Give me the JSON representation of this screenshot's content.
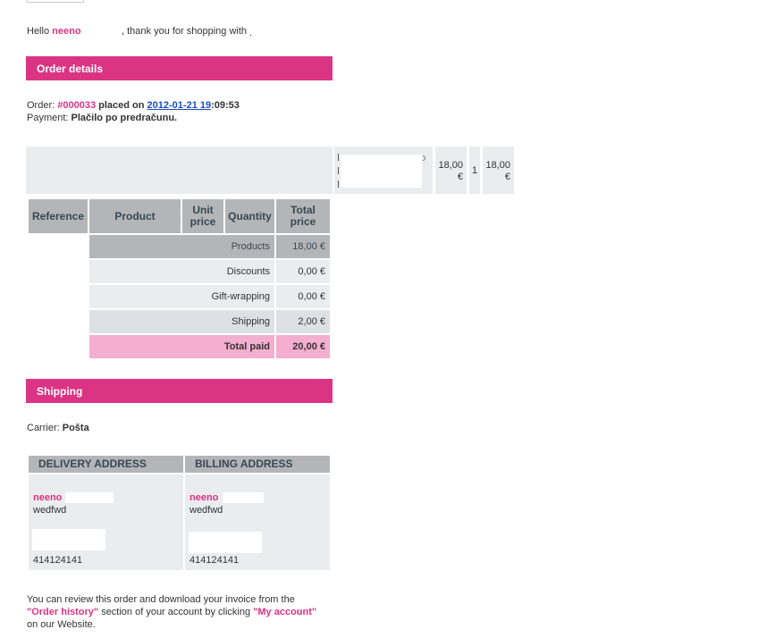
{
  "greeting": {
    "hello": "Hello",
    "name": "neeno",
    "thanks": ", thank you for shopping with",
    "shop_dot": "."
  },
  "order_details": {
    "title": "Order details",
    "order_label": "Order:",
    "order_number": "#000033",
    "placed_on": "placed on",
    "date_link": "2012-01-21 19",
    "time_rest": ":09:53",
    "payment_label": "Payment:",
    "payment_value": "Plačilo po predračunu."
  },
  "product_row": {
    "unit_price": [
      "18,00",
      "€"
    ],
    "quantity": "1",
    "total_price": [
      "18,00",
      "€"
    ]
  },
  "table": {
    "headers": {
      "reference": "Reference",
      "product": "Product",
      "unit_price": [
        "Unit",
        "price"
      ],
      "quantity": "Quantity",
      "total_price": [
        "Total",
        "price"
      ]
    },
    "summary": [
      {
        "label": "Products",
        "value": "18,00 €"
      },
      {
        "label": "Discounts",
        "value": "0,00 €"
      },
      {
        "label": "Gift-wrapping",
        "value": "0,00 €"
      },
      {
        "label": "Shipping",
        "value": "2,00 €"
      },
      {
        "label": "Total paid",
        "value": "20,00 €"
      }
    ]
  },
  "shipping": {
    "title": "Shipping",
    "carrier_label": "Carrier:",
    "carrier_value": "Pošta"
  },
  "addresses": {
    "delivery": {
      "title": "DELIVERY ADDRESS",
      "name": "neeno",
      "line": "wedfwd",
      "phone": "414124141"
    },
    "billing": {
      "title": "BILLING ADDRESS",
      "name": "neeno",
      "line": "wedfwd",
      "phone": "414124141"
    }
  },
  "footer": {
    "line1": "You can review this order and download your invoice from the",
    "order_history": "\"Order history\"",
    "mid": "section of your account by clicking",
    "my_account": "\"My account\"",
    "line3": "on our Website."
  },
  "colors": {
    "accent": "#db3484",
    "header_grey": "#b4b5b9",
    "row_grey": "#ebecee",
    "total_pink": "#f3aed0"
  }
}
